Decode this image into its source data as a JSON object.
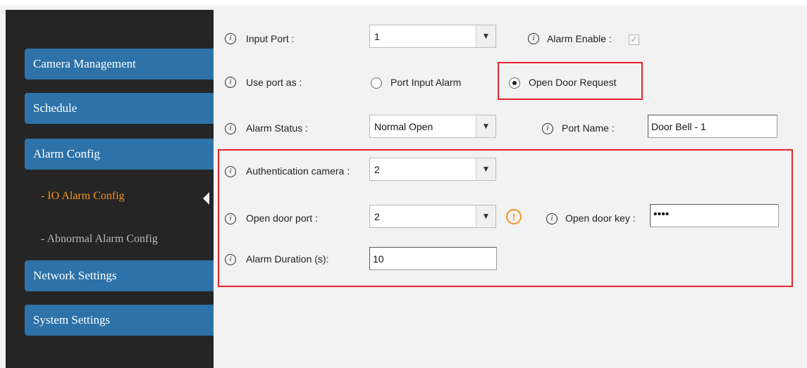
{
  "sidebar": {
    "nav": [
      {
        "label": "Camera Management"
      },
      {
        "label": "Schedule"
      },
      {
        "label": "Alarm Config"
      },
      {
        "label": "Network Settings"
      },
      {
        "label": "System Settings"
      }
    ],
    "sub": [
      {
        "label": "- IO Alarm Config",
        "active": true
      },
      {
        "label": "- Abnormal Alarm Config",
        "active": false
      }
    ]
  },
  "form": {
    "input_port": {
      "label": "Input Port :",
      "value": "1"
    },
    "alarm_enable": {
      "label": "Alarm Enable :",
      "checked": true
    },
    "use_port_as": {
      "label": "Use port as :",
      "options": [
        "Port Input Alarm",
        "Open Door Request"
      ],
      "selected": "Open Door Request"
    },
    "alarm_status": {
      "label": "Alarm Status :",
      "value": "Normal Open"
    },
    "port_name": {
      "label": "Port Name :",
      "value": "Door Bell - 1"
    },
    "auth_camera": {
      "label": "Authentication camera :",
      "value": "2"
    },
    "open_door_port": {
      "label": "Open door port :",
      "value": "2"
    },
    "open_door_key": {
      "label": "Open door key :",
      "value": "••••"
    },
    "alarm_duration": {
      "label": "Alarm Duration (s):",
      "value": "10"
    }
  },
  "icons": {
    "info": "info-icon",
    "warning": "warning-icon",
    "dropdown": "dropdown-arrow-icon"
  },
  "colors": {
    "nav_bg": "#2d72a8",
    "active_sub": "#f39323",
    "highlight": "#e3242b",
    "sidebar_bg": "#252525"
  }
}
